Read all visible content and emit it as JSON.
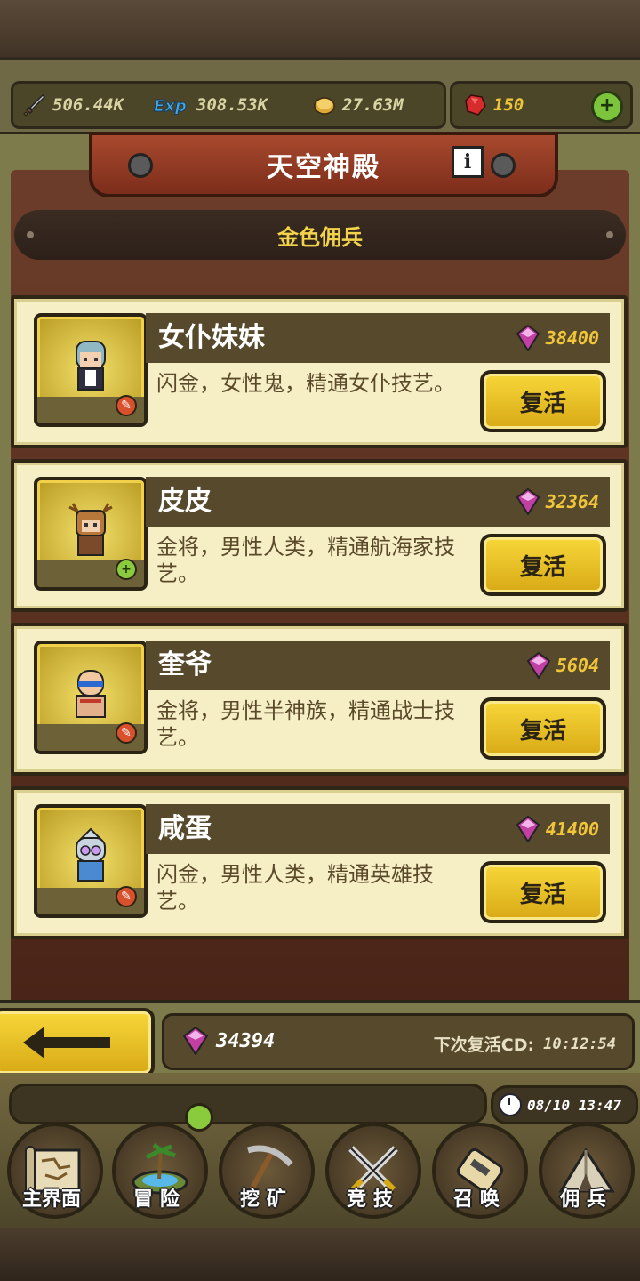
{
  "resources": {
    "attack": {
      "icon": "sword-icon",
      "value": "506.44K"
    },
    "exp": {
      "icon": "exp-icon",
      "value": "308.53K"
    },
    "gold": {
      "icon": "coin-icon",
      "value": "27.63M"
    },
    "gems": {
      "icon": "ruby-icon",
      "value": "150"
    },
    "add_label": "+"
  },
  "header": {
    "title": "天空神殿",
    "info_label": "i",
    "subtitle": "金色佣兵"
  },
  "mercenaries": [
    {
      "name": "女仆妹妹",
      "cost": "38400",
      "desc": "闪金，女性鬼，精通女仆技艺。",
      "revive_label": "复活",
      "badge": "✎"
    },
    {
      "name": "皮皮",
      "cost": "32364",
      "desc": "金将，男性人类，精通航海家技艺。",
      "revive_label": "复活",
      "badge": "+"
    },
    {
      "name": "奎爷",
      "cost": "5604",
      "desc": "金将，男性半神族，精通战士技艺。",
      "revive_label": "复活",
      "badge": "✎"
    },
    {
      "name": "咸蛋",
      "cost": "41400",
      "desc": "闪金，男性人类，精通英雄技艺。",
      "revive_label": "复活",
      "badge": "✎"
    }
  ],
  "footer": {
    "balance": "34394",
    "cd_label": "下次复活CD:",
    "cd_value": "10:12:54",
    "datetime": "08/10 13:47"
  },
  "nav": [
    {
      "label": "主界面",
      "icon": "map-scroll-icon"
    },
    {
      "label": "冒 险",
      "icon": "island-icon"
    },
    {
      "label": "挖 矿",
      "icon": "pickaxe-icon"
    },
    {
      "label": "竞 技",
      "icon": "crossed-swords-icon"
    },
    {
      "label": "召 唤",
      "icon": "summon-scroll-icon"
    },
    {
      "label": "佣 兵",
      "icon": "tent-icon"
    }
  ],
  "colors": {
    "accent_gold": "#f0c53a",
    "button_yellow": "#f7d73a",
    "banner_red": "#a8492e",
    "card_bg": "#f6efc6",
    "gem_purple": "#c23fa3"
  }
}
